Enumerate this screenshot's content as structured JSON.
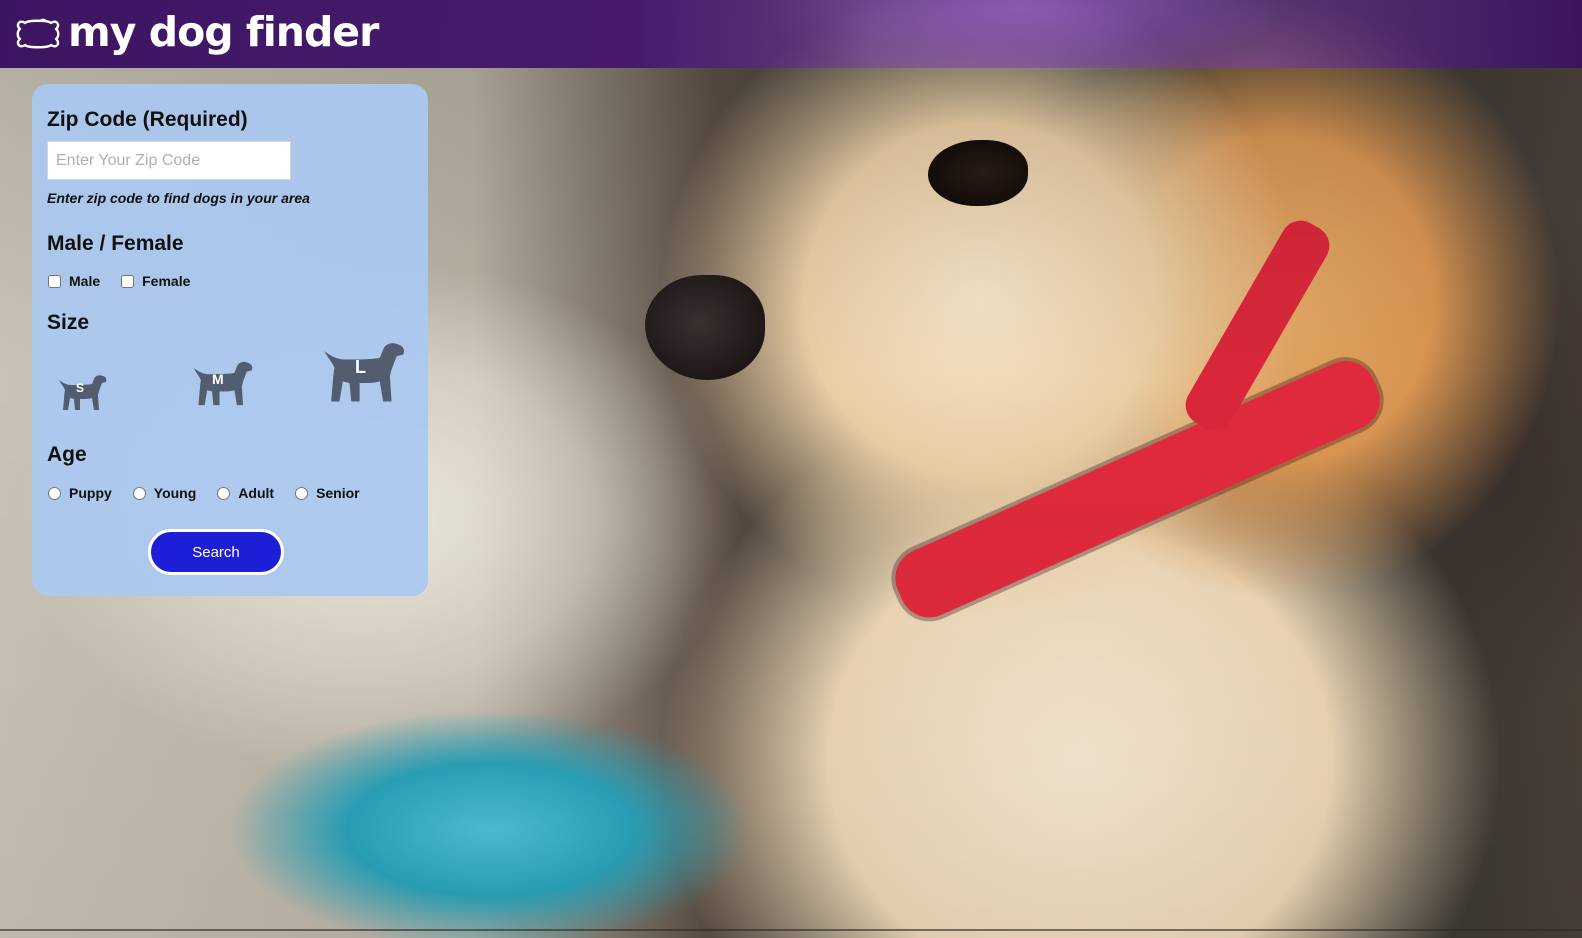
{
  "header": {
    "logo_text": "my dog finder",
    "logo_icon": "dog-bone-icon"
  },
  "form": {
    "zip": {
      "title": "Zip Code (Required)",
      "placeholder": "Enter Your Zip Code",
      "value": "",
      "hint": "Enter zip code to find dogs in your area"
    },
    "gender": {
      "title": "Male / Female",
      "options": [
        "Male",
        "Female"
      ]
    },
    "size": {
      "title": "Size",
      "options": [
        {
          "letter": "S",
          "icon": "small-dog-icon"
        },
        {
          "letter": "M",
          "icon": "medium-dog-icon"
        },
        {
          "letter": "L",
          "icon": "large-dog-icon"
        }
      ]
    },
    "age": {
      "title": "Age",
      "options": [
        "Puppy",
        "Young",
        "Adult",
        "Senior"
      ]
    },
    "search_label": "Search"
  },
  "colors": {
    "header_bg": "#3a1260",
    "panel_bg": "#aac8f0",
    "button_bg": "#1c1fd6",
    "dog_icon": "#525e70"
  }
}
